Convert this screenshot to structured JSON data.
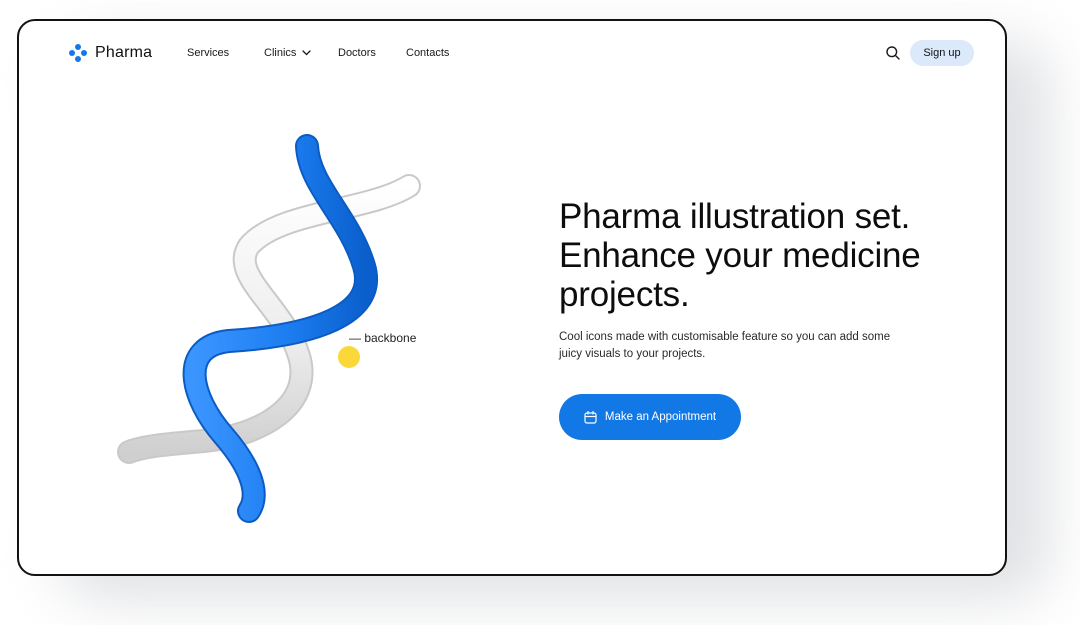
{
  "brand": {
    "name": "Pharma",
    "accent": "#1479e8"
  },
  "nav": {
    "items": [
      {
        "label": "Services"
      },
      {
        "label": "Clinics",
        "has_dropdown": true
      },
      {
        "label": "Doctors"
      },
      {
        "label": "Contacts"
      }
    ],
    "search_icon": "search-icon",
    "signup_label": "Sign up"
  },
  "illustration": {
    "callout": "— backbone",
    "colors": {
      "blue": "#1c7df0",
      "white": "#f2f2f2",
      "marker": "#fbd83a"
    }
  },
  "hero": {
    "title": "Pharma illustration set. Enhance your medicine projects.",
    "subtitle": "Cool icons made with customisable feature so you can add some juicy visuals to your projects.",
    "cta_label": "Make an Appointment",
    "cta_icon": "calendar-icon"
  }
}
